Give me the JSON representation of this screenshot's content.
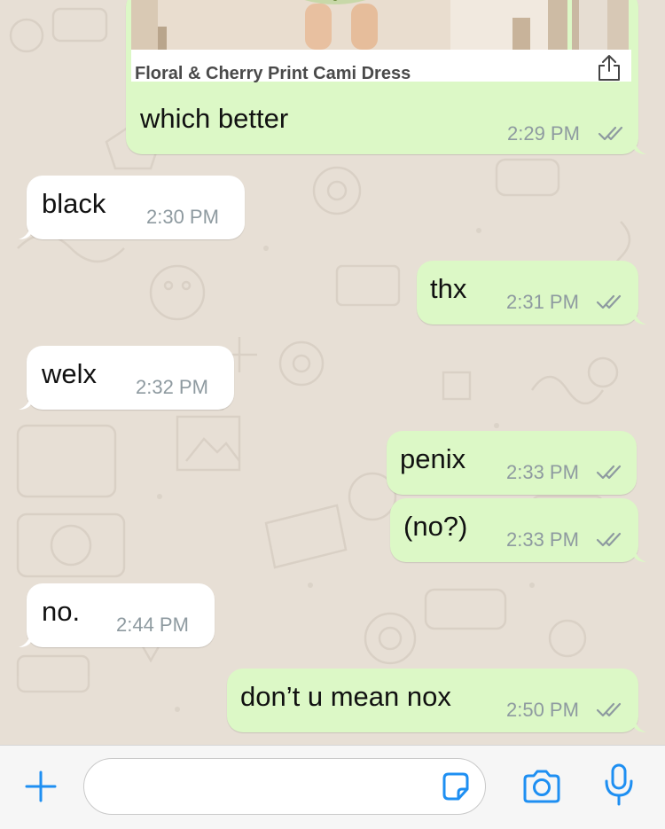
{
  "colors": {
    "outgoing_bubble": "#dcf8c6",
    "incoming_bubble": "#ffffff",
    "chat_background": "#e7dfd5",
    "accent_blue": "#1e8ff2",
    "read_ticks": "#8e9aa0"
  },
  "product_card": {
    "title": "Floral & Cherry Print Cami Dress",
    "share_icon": "share-icon"
  },
  "messages": [
    {
      "direction": "outgoing",
      "text": "which better",
      "time": "2:29 PM",
      "status": "read"
    },
    {
      "direction": "incoming",
      "text": "black",
      "time": "2:30 PM"
    },
    {
      "direction": "outgoing",
      "text": "thx",
      "time": "2:31 PM",
      "status": "read"
    },
    {
      "direction": "incoming",
      "text": "welx",
      "time": "2:32 PM"
    },
    {
      "direction": "outgoing",
      "text": "penix",
      "time": "2:33 PM",
      "status": "read"
    },
    {
      "direction": "outgoing",
      "text": "(no?)",
      "time": "2:33 PM",
      "status": "read"
    },
    {
      "direction": "incoming",
      "text": "no.",
      "time": "2:44 PM"
    },
    {
      "direction": "outgoing",
      "text": "don’t u mean nox",
      "time": "2:50 PM",
      "status": "read"
    }
  ],
  "input_bar": {
    "placeholder": "",
    "icons": [
      "plus-icon",
      "sticker-icon",
      "camera-icon",
      "microphone-icon"
    ]
  }
}
